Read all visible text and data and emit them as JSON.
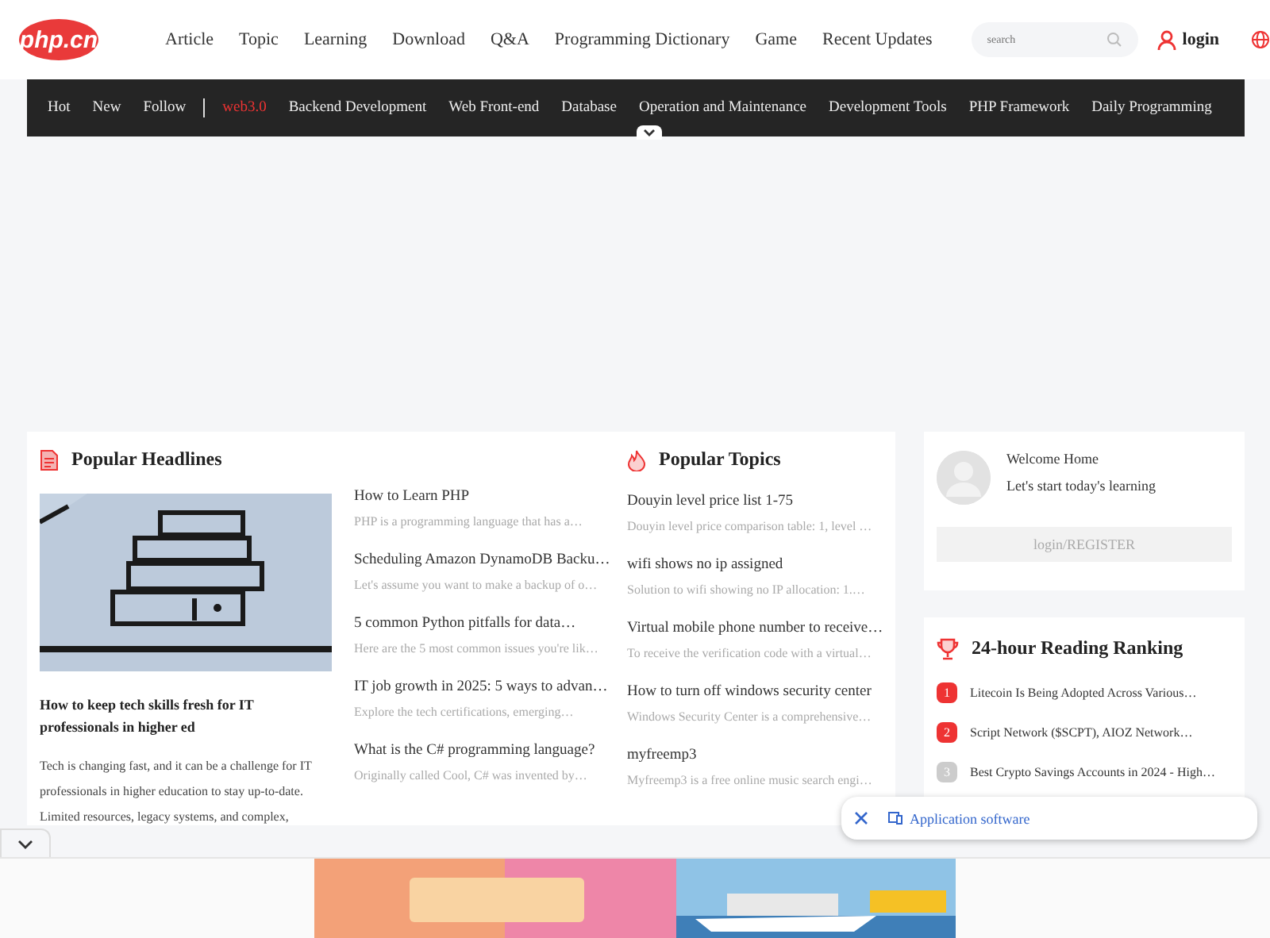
{
  "header": {
    "logo": "php.cn",
    "menu": [
      "Article",
      "Topic",
      "Learning",
      "Download",
      "Q&A",
      "Programming Dictionary",
      "Game",
      "Recent Updates"
    ],
    "search": {
      "placeholder": "search"
    },
    "login": "login"
  },
  "nav": {
    "items": [
      {
        "label": "Hot",
        "highlighted": false
      },
      {
        "label": "New",
        "highlighted": false
      },
      {
        "label": "Follow",
        "highlighted": false
      },
      {
        "label": "web3.0",
        "highlighted": true
      },
      {
        "label": "Backend Development",
        "highlighted": false
      },
      {
        "label": "Web Front-end",
        "highlighted": false
      },
      {
        "label": "Database",
        "highlighted": false
      },
      {
        "label": "Operation and Maintenance",
        "highlighted": false
      },
      {
        "label": "Development Tools",
        "highlighted": false
      },
      {
        "label": "PHP Framework",
        "highlighted": false
      },
      {
        "label": "Daily Programming",
        "highlighted": false
      }
    ]
  },
  "headlines": {
    "title": "Popular Headlines",
    "feature": {
      "kind": "picture",
      "title": "How to keep tech skills fresh for IT professionals in higher ed",
      "summary": "Tech is changing fast, and it can be a challenge for IT professionals in higher education to stay up-to-date. Limited resources, legacy systems, and complex,"
    },
    "items": [
      {
        "title": "How to Learn PHP",
        "summary": "PHP is a programming language that has a…"
      },
      {
        "title": "Scheduling Amazon DynamoDB Backu…",
        "summary": "Let's assume you want to make a backup of o…"
      },
      {
        "title": "5 common Python pitfalls for data…",
        "summary": "Here are the 5 most common issues you're lik…"
      },
      {
        "title": "IT job growth in 2025: 5 ways to advan…",
        "summary": "Explore the tech certifications, emerging…"
      },
      {
        "title": "What is the C# programming language?",
        "summary": "Originally called Cool, C# was invented by…"
      }
    ]
  },
  "topics": {
    "title": "Popular Topics",
    "items": [
      {
        "title": "Douyin level price list 1-75",
        "summary": "Douyin level price comparison table: 1, level …"
      },
      {
        "title": "wifi shows no ip assigned",
        "summary": "Solution to wifi showing no IP allocation: 1.…"
      },
      {
        "title": "Virtual mobile phone number to receive…",
        "summary": "To receive the verification code with a virtual…"
      },
      {
        "title": "How to turn off windows security center",
        "summary": "Windows Security Center is a comprehensive…"
      },
      {
        "title": "myfreemp3",
        "summary": "Myfreemp3 is a free online music search engi…"
      }
    ]
  },
  "profile": {
    "greeting": "Welcome Home",
    "subtitle": "Let's start today's learning",
    "button": "login/REGISTER"
  },
  "ranking": {
    "title": "24-hour Reading Ranking",
    "items": [
      {
        "rank": "1",
        "title": "Litecoin Is Being Adopted Across Various…",
        "hot": true
      },
      {
        "rank": "2",
        "title": "Script Network ($SCPT), AIOZ Network…",
        "hot": true
      },
      {
        "rank": "3",
        "title": "Best Crypto Savings Accounts in 2024 - High…",
        "hot": false
      }
    ]
  },
  "popup": {
    "label": "Application software"
  }
}
